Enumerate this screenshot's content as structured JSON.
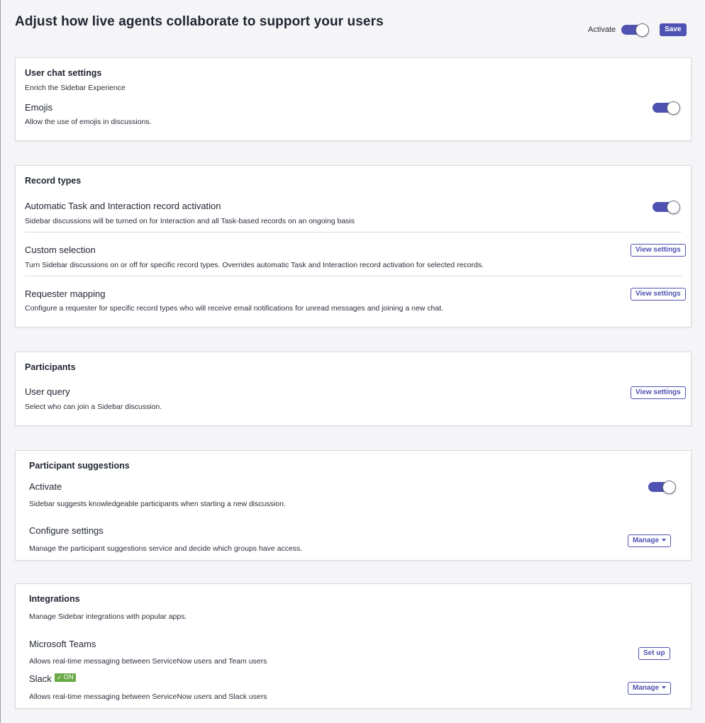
{
  "header": {
    "title": "Adjust how live agents collaborate to support your users",
    "activate_label": "Activate",
    "activate_on": true,
    "save_label": "Save"
  },
  "user_chat": {
    "title": "User chat settings",
    "subtitle": "Enrich the Sidebar Experience",
    "emojis_title": "Emojis",
    "emojis_desc": "Allow the use of emojis in discussions.",
    "emojis_on": true
  },
  "record_types": {
    "title": "Record types",
    "auto_title": "Automatic Task and Interaction record activation",
    "auto_desc": "Sidebar discussions will be turned on for Interaction and all Task-based records on an ongoing basis",
    "auto_on": true,
    "custom_title": "Custom selection",
    "custom_desc": "Turn Sidebar discussions on or off for specific record types. Overrides automatic Task and Interaction record activation for selected records.",
    "custom_button": "View settings",
    "requester_title": "Requester mapping",
    "requester_desc": "Configure a requester for specific record types who will receive email notifications for unread messages and joining a new chat.",
    "requester_button": "View settings"
  },
  "participants": {
    "title": "Participants",
    "query_title": "User query",
    "query_desc": "Select who can join a Sidebar discussion.",
    "query_button": "View settings"
  },
  "suggestions": {
    "title": "Participant suggestions",
    "activate_title": "Activate",
    "activate_desc": "Sidebar suggests knowledgeable participants when starting a new discussion.",
    "activate_on": true,
    "configure_title": "Configure settings",
    "configure_desc": "Manage the participant suggestions service and decide which groups have access.",
    "configure_button": "Manage"
  },
  "integrations": {
    "title": "Integrations",
    "subtitle": "Manage Sidebar integrations with popular apps.",
    "teams_title": "Microsoft Teams",
    "teams_desc": "Allows real-time messaging between ServiceNow users and Team users",
    "teams_button": "Set up",
    "slack_title": "Slack",
    "slack_badge": "ON",
    "slack_desc": "Allows real-time messaging between ServiceNow users and Slack users",
    "slack_button": "Manage"
  },
  "colors": {
    "accent": "#4f52b2",
    "on_badge": "#6aaa45",
    "background": "#f5f5f7"
  },
  "icons": {
    "caret": "chevron-down-icon",
    "check": "check-icon"
  }
}
